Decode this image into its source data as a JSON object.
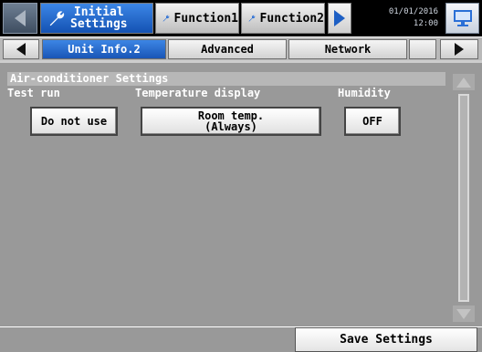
{
  "top_tabs": [
    {
      "label_line1": "Initial",
      "label_line2": "Settings",
      "icon": "wrench-icon",
      "active": true
    },
    {
      "label": "Function1",
      "icon": "wrench-icon",
      "active": false
    },
    {
      "label": "Function2",
      "icon": "wrench-icon",
      "active": false
    }
  ],
  "datetime": {
    "date": "01/01/2016",
    "time": "12:00"
  },
  "sub_tabs": [
    {
      "label": "Unit Info.2",
      "active": true
    },
    {
      "label": "Advanced",
      "active": false
    },
    {
      "label": "Network",
      "active": false
    }
  ],
  "section": {
    "title": "Air-conditioner Settings"
  },
  "settings": {
    "test_run": {
      "label": "Test run",
      "value": "Do not use"
    },
    "temperature_display": {
      "label": "Temperature display",
      "value_line1": "Room temp.",
      "value_line2": "(Always)"
    },
    "humidity": {
      "label": "Humidity",
      "value": "OFF"
    }
  },
  "footer": {
    "save_label": "Save Settings"
  },
  "colors": {
    "active_tab": "#1d62c8",
    "content_bg": "#999999",
    "header_bg": "#000000"
  }
}
